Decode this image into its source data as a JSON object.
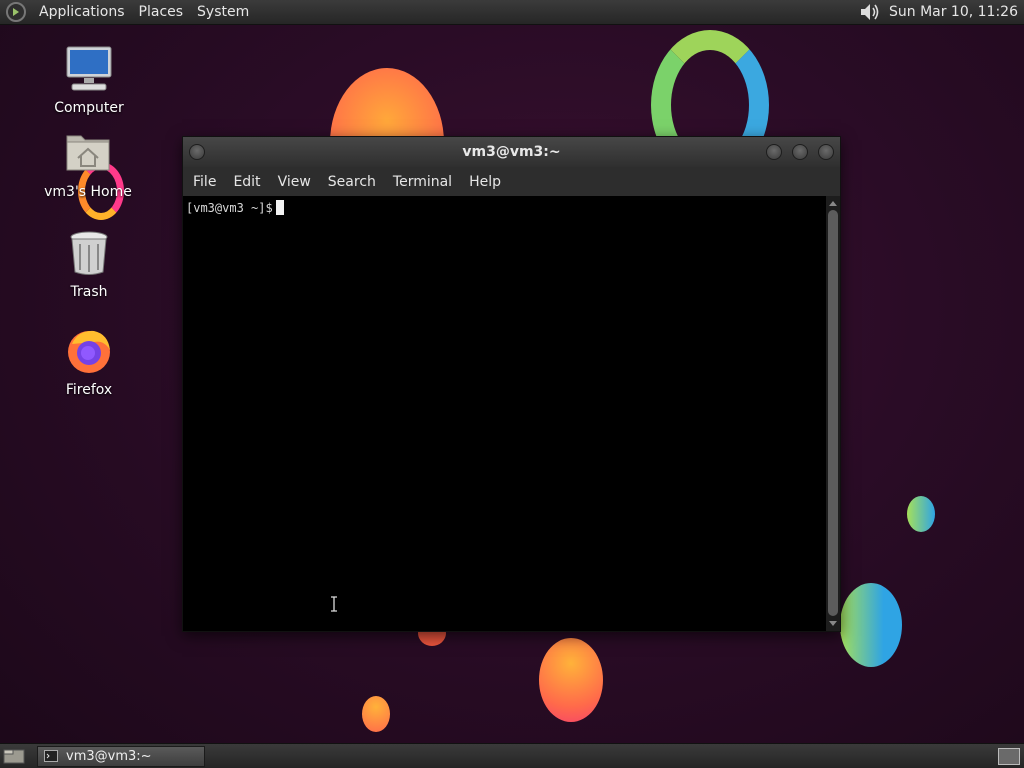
{
  "top_panel": {
    "menus": [
      "Applications",
      "Places",
      "System"
    ],
    "clock": "Sun Mar 10, 11:26"
  },
  "desktop_icons": [
    {
      "label": "Computer"
    },
    {
      "label": "vm3's Home"
    },
    {
      "label": "Trash"
    },
    {
      "label": "Firefox"
    }
  ],
  "terminal": {
    "title": "vm3@vm3:~",
    "menu": [
      "File",
      "Edit",
      "View",
      "Search",
      "Terminal",
      "Help"
    ],
    "prompt": "[vm3@vm3 ~]$"
  },
  "taskbar": {
    "tasks": [
      {
        "label": "vm3@vm3:~"
      }
    ]
  },
  "colors": {
    "desktop_bg": "#2a0c26",
    "terminal_bg": "#000000",
    "panel_bg": "#2e2e2e"
  }
}
